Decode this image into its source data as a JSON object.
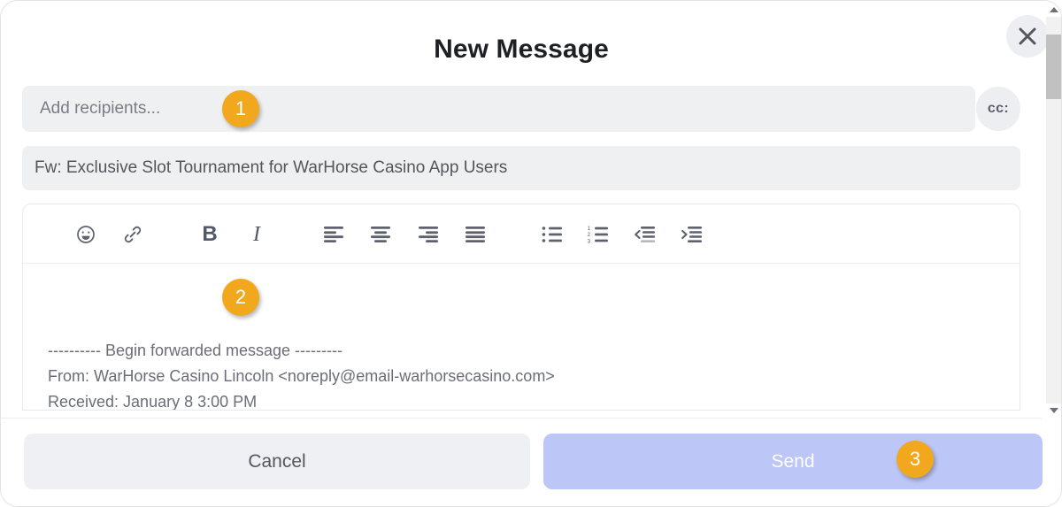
{
  "window": {
    "title": "New Message",
    "close_icon": "close-x-icon"
  },
  "recipients": {
    "value": "",
    "placeholder": "Add recipients...",
    "cc_label": "cc:"
  },
  "subject": {
    "value": "Fw: Exclusive Slot Tournament for WarHorse Casino App Users",
    "placeholder": "Subject"
  },
  "editor": {
    "toolbar": [
      {
        "name": "emoji-icon",
        "label": "☺"
      },
      {
        "name": "link-icon",
        "label": "🔗"
      },
      {
        "name": "bold-icon",
        "label": "B"
      },
      {
        "name": "italic-icon",
        "label": "I"
      },
      {
        "name": "align-left-icon",
        "label": "Align left"
      },
      {
        "name": "align-center-icon",
        "label": "Align center"
      },
      {
        "name": "align-right-icon",
        "label": "Align right"
      },
      {
        "name": "align-justify-icon",
        "label": "Justify"
      },
      {
        "name": "bulleted-list-icon",
        "label": "Bulleted list"
      },
      {
        "name": "numbered-list-icon",
        "label": "Numbered list"
      },
      {
        "name": "outdent-icon",
        "label": "Decrease indent"
      },
      {
        "name": "indent-icon",
        "label": "Increase indent"
      }
    ],
    "body": "---------- Begin forwarded message ---------\nFrom: WarHorse Casino Lincoln <noreply@email-warhorsecasino.com>\nReceived: January 8 3:00 PM"
  },
  "footer": {
    "cancel_label": "Cancel",
    "send_label": "Send"
  },
  "annotations": [
    {
      "number": "1",
      "target": "recipients-field"
    },
    {
      "number": "2",
      "target": "editor-body"
    },
    {
      "number": "3",
      "target": "send-button"
    }
  ],
  "colors": {
    "badge": "#f2a81d",
    "send_button": "#bcc6f7",
    "field_background": "#eff0f2",
    "icon": "#5f616e"
  }
}
